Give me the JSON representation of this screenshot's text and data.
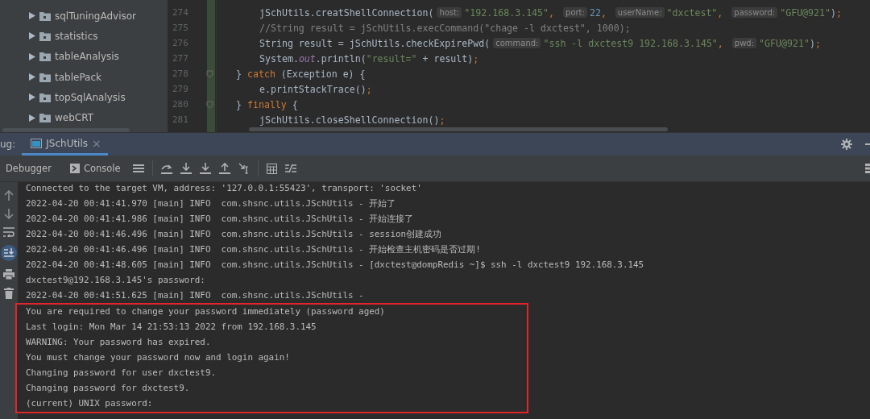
{
  "project_tree": {
    "items": [
      {
        "label": "sqlTuningAdvisor",
        "expanded": false
      },
      {
        "label": "statistics",
        "expanded": false
      },
      {
        "label": "tableAnalysis",
        "expanded": false
      },
      {
        "label": "tablePack",
        "expanded": false
      },
      {
        "label": "topSqlAnalysis",
        "expanded": false
      },
      {
        "label": "webCRT",
        "expanded": false
      }
    ]
  },
  "editor": {
    "lines": [
      {
        "number": "274",
        "nested": true,
        "tokens": [
          {
            "kind": "plain",
            "text": "jSchUtils.creatShellConnection("
          },
          {
            "kind": "hint",
            "text": "host:"
          },
          {
            "kind": "string",
            "text": "\"192.168.3.145\""
          },
          {
            "kind": "punct",
            "text": ", "
          },
          {
            "kind": "hint",
            "text": "port:"
          },
          {
            "kind": "number",
            "text": "22"
          },
          {
            "kind": "punct",
            "text": ", "
          },
          {
            "kind": "hint",
            "text": "userName:"
          },
          {
            "kind": "string",
            "text": "\"dxctest\""
          },
          {
            "kind": "punct",
            "text": ", "
          },
          {
            "kind": "hint",
            "text": "password:"
          },
          {
            "kind": "string",
            "text": "\"GFU@921\""
          },
          {
            "kind": "plain",
            "text": ")"
          },
          {
            "kind": "punct",
            "text": ";"
          }
        ]
      },
      {
        "number": "275",
        "nested": true,
        "tokens": [
          {
            "kind": "comment",
            "text": "//String result = jSchUtils.execCommand(\"chage -l dxctest\", 1000);"
          }
        ]
      },
      {
        "number": "276",
        "nested": true,
        "tokens": [
          {
            "kind": "plain",
            "text": "String result = jSchUtils.checkExpirePwd("
          },
          {
            "kind": "hint",
            "text": "command:"
          },
          {
            "kind": "string",
            "text": "\"ssh -l dxctest9 192.168.3.145\""
          },
          {
            "kind": "punct",
            "text": ", "
          },
          {
            "kind": "hint",
            "text": "pwd:"
          },
          {
            "kind": "string",
            "text": "\"GFU@921\""
          },
          {
            "kind": "plain",
            "text": ")"
          },
          {
            "kind": "punct",
            "text": ";"
          }
        ]
      },
      {
        "number": "277",
        "nested": true,
        "tokens": [
          {
            "kind": "plain",
            "text": "System."
          },
          {
            "kind": "field",
            "text": "out"
          },
          {
            "kind": "plain",
            "text": ".println("
          },
          {
            "kind": "string",
            "text": "\"result=\""
          },
          {
            "kind": "plain",
            "text": " + result)"
          },
          {
            "kind": "punct",
            "text": ";"
          }
        ]
      },
      {
        "number": "278",
        "nested": false,
        "tokens": [
          {
            "kind": "plain",
            "text": "} "
          },
          {
            "kind": "keyword",
            "text": "catch"
          },
          {
            "kind": "plain",
            "text": " (Exception e) {"
          }
        ]
      },
      {
        "number": "279",
        "nested": true,
        "tokens": [
          {
            "kind": "plain",
            "text": "e.printStackTrace()"
          },
          {
            "kind": "punct",
            "text": ";"
          }
        ]
      },
      {
        "number": "280",
        "nested": false,
        "tokens": [
          {
            "kind": "plain",
            "text": "} "
          },
          {
            "kind": "keyword",
            "text": "finally"
          },
          {
            "kind": "plain",
            "text": " {"
          }
        ]
      },
      {
        "number": "281",
        "nested": true,
        "tokens": [
          {
            "kind": "plain",
            "text": "jSchUtils.closeShellConnection()"
          },
          {
            "kind": "punct",
            "text": ";"
          }
        ]
      }
    ]
  },
  "debug_panel": {
    "label": "ug:",
    "tabs": [
      {
        "label": "JSchUtils",
        "selected": true,
        "close": "×"
      }
    ],
    "toolbar": {
      "views": [
        "Debugger",
        "Console"
      ]
    }
  },
  "console": {
    "lines": [
      "Connected to the target VM, address: '127.0.0.1:55423', transport: 'socket'",
      "2022-04-20 00:41:41.970 [main] INFO  com.shsnc.utils.JSchUtils - 开始了",
      "2022-04-20 00:41:41.986 [main] INFO  com.shsnc.utils.JSchUtils - 开始连接了",
      "2022-04-20 00:41:46.496 [main] INFO  com.shsnc.utils.JSchUtils - session创建成功",
      "2022-04-20 00:41:46.496 [main] INFO  com.shsnc.utils.JSchUtils - 开始检查主机密码是否过期!",
      "2022-04-20 00:41:48.605 [main] INFO  com.shsnc.utils.JSchUtils - [dxctest@dompRedis ~]$ ssh -l dxctest9 192.168.3.145",
      "dxctest9@192.168.3.145's password:",
      "2022-04-20 00:41:51.625 [main] INFO  com.shsnc.utils.JSchUtils -"
    ],
    "highlighted_lines": [
      "You are required to change your password immediately (password aged)",
      "Last login: Mon Mar 14 21:53:13 2022 from 192.168.3.145",
      "WARNING: Your password has expired.",
      "You must change your password now and login again!",
      "Changing password for user dxctest9.",
      "Changing password for dxctest9.",
      "(current) UNIX password:"
    ]
  }
}
